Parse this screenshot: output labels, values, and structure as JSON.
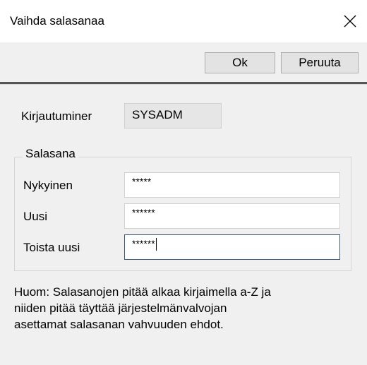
{
  "dialog": {
    "title": "Vaihda salasanaa"
  },
  "toolbar": {
    "ok_label": "Ok",
    "cancel_label": "Peruuta"
  },
  "login": {
    "label": "Kirjautuminer",
    "value": "SYSADM"
  },
  "password_group": {
    "legend": "Salasana",
    "current_label": "Nykyinen",
    "current_value": "*****",
    "new_label": "Uusi",
    "new_value": "******",
    "repeat_label": "Toista uusi",
    "repeat_value": "******"
  },
  "note": {
    "line1": "Huom: Salasanojen pitää alkaa kirjaimella a-Z ja",
    "line2": "niiden pitää täyttää järjestelmänvalvojan",
    "line3": "asettamat salasanan vahvuuden ehdot."
  },
  "icons": {
    "close": "close-icon"
  },
  "colors": {
    "separator": "#555555",
    "focus_border": "#3c5a7c",
    "button_bg": "#e3e3e3"
  }
}
